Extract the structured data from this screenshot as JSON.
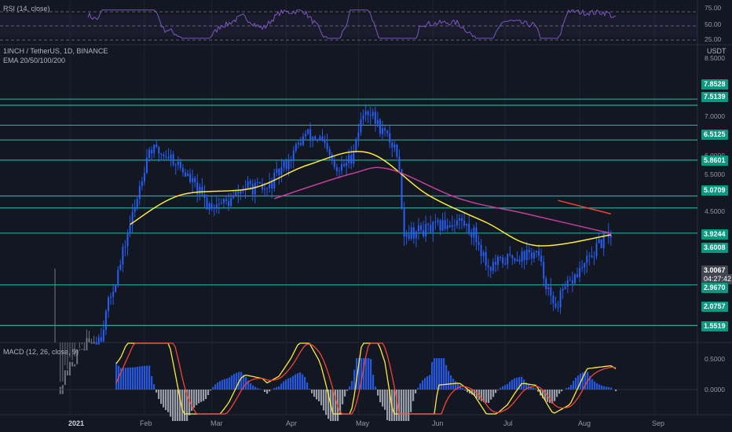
{
  "colors": {
    "background": "#131722",
    "grid": "#1f2330",
    "separator": "#2a2e39",
    "level": "#26a69a",
    "candle": "#2962ff",
    "candle_early": "#787b86",
    "ema20": "#ffeb3b",
    "ema50": "#c2409c",
    "ema200": "#f44336",
    "rsi": "#7e57c2",
    "macd": "#ffeb3b",
    "signal": "#f44336",
    "hist_up": "#2962ff",
    "hist_down": "#b2b5be"
  },
  "header": {
    "symbol": "1INCH / TetherUS, 1D, BINANCE",
    "indicator": "EMA 20/50/100/200",
    "currency": "USDT"
  },
  "rsi": {
    "label": "RSI (14, close)",
    "ticks": [
      "75.00",
      "50.00",
      "25.00"
    ]
  },
  "macd": {
    "label": "MACD (12, 26, close, 9)",
    "ticks": [
      "0.5000",
      "0.0000"
    ]
  },
  "price_ticks": [
    "8.5000",
    "7.0000",
    "6.0000",
    "5.5000",
    "4.5000"
  ],
  "x_ticks": [
    "2021",
    "Feb",
    "Mar",
    "Apr",
    "May",
    "Jun",
    "Jul",
    "Aug",
    "Sep"
  ],
  "current": {
    "price": "3.0067",
    "countdown": "04:27:42",
    "ema_value": "2.9670"
  },
  "chart_data": {
    "type": "candlestick",
    "symbol": "1INCH / TetherUS",
    "timeframe": "1D",
    "exchange": "BINANCE",
    "y_scale": "log",
    "levels": [
      7.8528,
      7.5139,
      6.5125,
      5.8601,
      5.0709,
      3.9244,
      3.6008,
      3.0067,
      2.0757,
      1.5519
    ],
    "close_path": [
      {
        "date": "2020-12-28",
        "close": 1.0
      },
      {
        "date": "2021-01-05",
        "close": 1.3
      },
      {
        "date": "2021-01-14",
        "close": 1.45
      },
      {
        "date": "2021-01-22",
        "close": 2.4
      },
      {
        "date": "2021-01-28",
        "close": 3.6
      },
      {
        "date": "2021-02-03",
        "close": 5.5
      },
      {
        "date": "2021-02-12",
        "close": 5.2
      },
      {
        "date": "2021-02-20",
        "close": 4.4
      },
      {
        "date": "2021-02-27",
        "close": 3.7
      },
      {
        "date": "2021-03-08",
        "close": 3.75
      },
      {
        "date": "2021-03-15",
        "close": 4.2
      },
      {
        "date": "2021-03-24",
        "close": 4.1
      },
      {
        "date": "2021-04-03",
        "close": 5.2
      },
      {
        "date": "2021-04-09",
        "close": 6.1
      },
      {
        "date": "2021-04-15",
        "close": 5.9
      },
      {
        "date": "2021-04-22",
        "close": 4.6
      },
      {
        "date": "2021-04-28",
        "close": 5.2
      },
      {
        "date": "2021-05-04",
        "close": 7.4
      },
      {
        "date": "2021-05-10",
        "close": 6.4
      },
      {
        "date": "2021-05-17",
        "close": 5.4
      },
      {
        "date": "2021-05-20",
        "close": 3.0
      },
      {
        "date": "2021-05-31",
        "close": 3.1
      },
      {
        "date": "2021-06-12",
        "close": 3.3
      },
      {
        "date": "2021-06-18",
        "close": 3.0
      },
      {
        "date": "2021-06-24",
        "close": 2.35
      },
      {
        "date": "2021-07-05",
        "close": 2.55
      },
      {
        "date": "2021-07-14",
        "close": 2.6
      },
      {
        "date": "2021-07-21",
        "close": 1.75
      },
      {
        "date": "2021-07-28",
        "close": 2.1
      },
      {
        "date": "2021-08-04",
        "close": 2.45
      },
      {
        "date": "2021-08-14",
        "close": 3.05
      }
    ],
    "ema20": [
      {
        "date": "2021-01-26",
        "value": 3.2
      },
      {
        "date": "2021-02-16",
        "value": 3.95
      },
      {
        "date": "2021-03-18",
        "value": 4.15
      },
      {
        "date": "2021-04-10",
        "value": 4.9
      },
      {
        "date": "2021-05-05",
        "value": 5.35
      },
      {
        "date": "2021-05-30",
        "value": 3.95
      },
      {
        "date": "2021-06-23",
        "value": 3.25
      },
      {
        "date": "2021-07-14",
        "value": 2.75
      },
      {
        "date": "2021-08-14",
        "value": 2.97
      }
    ],
    "ema50": [
      {
        "date": "2021-03-27",
        "value": 3.85
      },
      {
        "date": "2021-04-28",
        "value": 4.6
      },
      {
        "date": "2021-05-14",
        "value": 4.75
      },
      {
        "date": "2021-06-12",
        "value": 3.85
      },
      {
        "date": "2021-07-10",
        "value": 3.45
      },
      {
        "date": "2021-08-14",
        "value": 3.0
      }
    ],
    "ema200": [
      {
        "date": "2021-07-23",
        "value": 3.8
      },
      {
        "date": "2021-08-14",
        "value": 3.45
      }
    ],
    "rsi_range": [
      25,
      75
    ],
    "macd_zero": 0
  }
}
